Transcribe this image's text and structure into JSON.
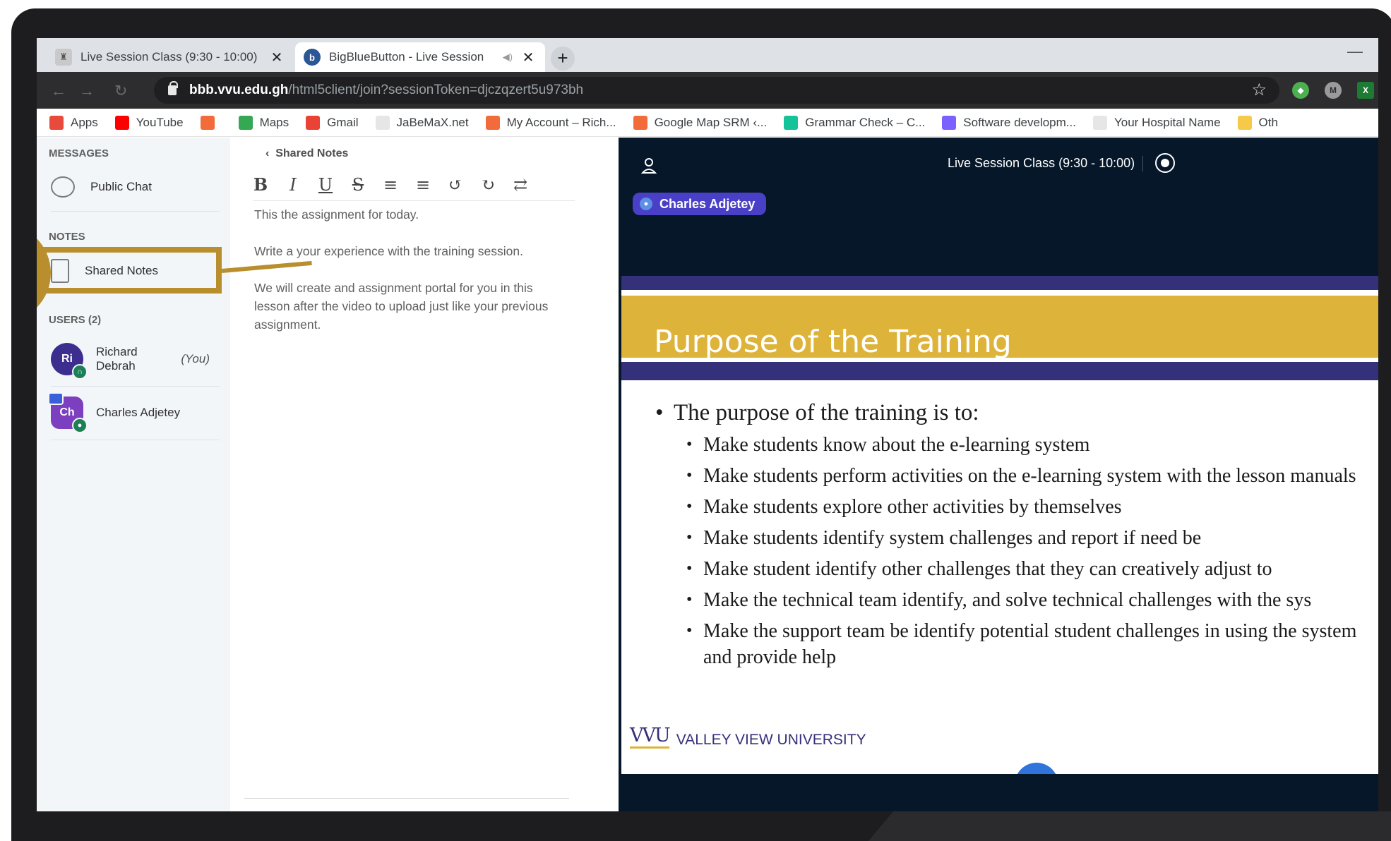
{
  "browser": {
    "tabs": [
      {
        "title": "Live Session Class (9:30 - 10:00)",
        "close": "✕"
      },
      {
        "title": "BigBlueButton - Live Session",
        "close": "✕"
      }
    ],
    "new_tab": "+",
    "minimize": "—",
    "url_host": "bbb.vvu.edu.gh",
    "url_path": "/html5client/join?sessionToken=djczqzert5u973bh",
    "bookmarks": [
      {
        "label": "Apps",
        "icon": "apps-grid-icon",
        "color": "#e84b3c"
      },
      {
        "label": "YouTube",
        "icon": "youtube-icon",
        "color": "#ff0000"
      },
      {
        "label": "",
        "icon": "bookmark-icon",
        "color": "#f26b3a"
      },
      {
        "label": "Maps",
        "icon": "maps-icon",
        "color": "#34a853"
      },
      {
        "label": "Gmail",
        "icon": "gmail-icon",
        "color": "#ea4335"
      },
      {
        "label": "JaBeMaX.net",
        "icon": "globe-icon",
        "color": "#e6e6e6"
      },
      {
        "label": "My Account – Rich...",
        "icon": "bookmark-icon",
        "color": "#f26b3a"
      },
      {
        "label": "Google Map SRM ‹...",
        "icon": "bookmark-icon",
        "color": "#f26b3a"
      },
      {
        "label": "Grammar Check – C...",
        "icon": "grammar-icon",
        "color": "#15c39a"
      },
      {
        "label": "Software developm...",
        "icon": "bolt-icon",
        "color": "#7b61ff"
      },
      {
        "label": "Your Hospital Name",
        "icon": "globe-icon",
        "color": "#e6e6e6"
      },
      {
        "label": "Oth",
        "icon": "folder-icon",
        "color": "#f7c948"
      }
    ]
  },
  "user_list": {
    "messages_title": "MESSAGES",
    "public_chat": "Public Chat",
    "notes_title": "NOTES",
    "shared_notes": "Shared Notes",
    "users_title": "USERS (2)",
    "users": [
      {
        "initials": "Ri",
        "name": "Richard Debrah",
        "suffix": "(You)"
      },
      {
        "initials": "Ch",
        "name": "Charles Adjetey",
        "suffix": ""
      }
    ]
  },
  "notes": {
    "back_label": "Shared Notes",
    "toolbar": [
      "B",
      "I",
      "U",
      "S",
      "≡",
      "≡",
      "↺",
      "↻",
      "⇄"
    ],
    "paragraphs": [
      "This the assignment for today.",
      "Write a your experience with the training session.",
      "We will create and assignment portal for you in this lesson after the video to upload just like your previous assignment."
    ]
  },
  "session": {
    "title": "Live Session Class (9:30 - 10:00)",
    "talker": "Charles Adjetey"
  },
  "slide": {
    "title": "Purpose of the Training",
    "lead": "The purpose of the training is to:",
    "bullets": [
      "Make students know about the e-learning system",
      "Make students perform activities on the e-learning system with the lesson manuals",
      "Make students explore other activities by themselves",
      "Make students identify system challenges and report if need be",
      "Make student identify other challenges that they can creatively adjust to",
      "Make the technical team identify, and solve technical challenges with the sys",
      "Make the support team be identify potential student challenges in using the system and provide help"
    ],
    "logo_mark": "VVU",
    "logo_text": "VALLEY VIEW UNIVERSITY"
  },
  "colors": {
    "accent_gold": "#ddb33a",
    "slide_navy": "#35307a",
    "main_bg": "#06172a",
    "audio_blue": "#2f73db",
    "callout": "#b98f2e"
  }
}
